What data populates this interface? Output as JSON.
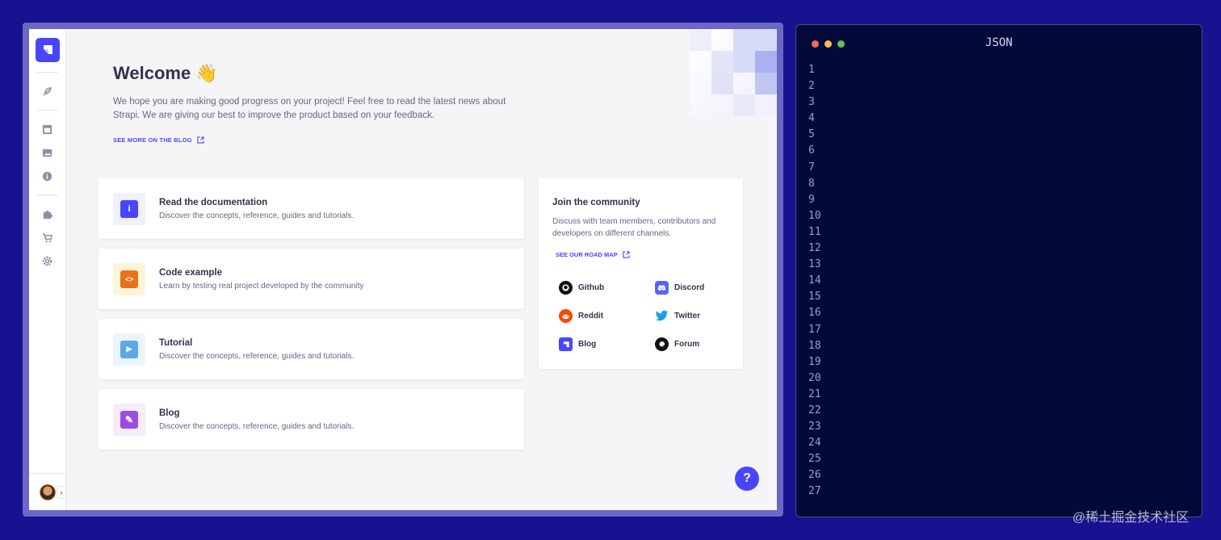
{
  "welcome": {
    "title": "Welcome",
    "emoji": "👋",
    "intro": "We hope you are making good progress on your project! Feel free to read the latest news about Strapi. We are giving our best to improve the product based on your feedback.",
    "blog_link": "SEE MORE ON THE BLOG"
  },
  "sidebar": {
    "items": [
      {
        "icon": "feather-icon"
      },
      {
        "icon": "layout-icon"
      },
      {
        "icon": "image-icon"
      },
      {
        "icon": "info-icon"
      },
      {
        "icon": "puzzle-icon"
      },
      {
        "icon": "cart-icon"
      },
      {
        "icon": "gear-icon"
      }
    ]
  },
  "cards": [
    {
      "title": "Read the documentation",
      "subtitle": "Discover the concepts, reference, guides and tutorials.",
      "icon": "info-icon",
      "icon_glyph": "i",
      "color": "#4945ff",
      "bg": "#f0f0ff"
    },
    {
      "title": "Code example",
      "subtitle": "Learn by testing real project developed by the community",
      "icon": "code-icon",
      "icon_glyph": "<>",
      "color": "#e8721a",
      "bg": "#fdf4dc"
    },
    {
      "title": "Tutorial",
      "subtitle": "Discover the concepts, reference, guides and tutorials.",
      "icon": "play-icon",
      "icon_glyph": "▶",
      "color": "#3c9be8",
      "bg": "#eaf5ff"
    },
    {
      "title": "Blog",
      "subtitle": "Discover the concepts, reference, guides and tutorials.",
      "icon": "feather-icon",
      "icon_glyph": "✎",
      "color": "#9736e8",
      "bg": "#f6ecfc"
    }
  ],
  "community": {
    "title": "Join the community",
    "description": "Discuss with team members, contributors and developers on different channels.",
    "roadmap_link": "SEE OUR ROAD MAP",
    "links": [
      {
        "label": "Github",
        "icon": "github-icon"
      },
      {
        "label": "Discord",
        "icon": "discord-icon"
      },
      {
        "label": "Reddit",
        "icon": "reddit-icon"
      },
      {
        "label": "Twitter",
        "icon": "twitter-icon"
      },
      {
        "label": "Blog",
        "icon": "strapi-icon"
      },
      {
        "label": "Forum",
        "icon": "forum-icon"
      }
    ]
  },
  "help": {
    "label": "?"
  },
  "editor": {
    "title": "JSON",
    "line_numbers": [
      "1",
      "2",
      "3",
      "4",
      "5",
      "6",
      "7",
      "8",
      "9",
      "10",
      "11",
      "12",
      "13",
      "14",
      "15",
      "16",
      "17",
      "18",
      "19",
      "20",
      "21",
      "22",
      "23",
      "24",
      "25",
      "26",
      "27"
    ]
  },
  "watermark": "@稀土掘金技术社区"
}
